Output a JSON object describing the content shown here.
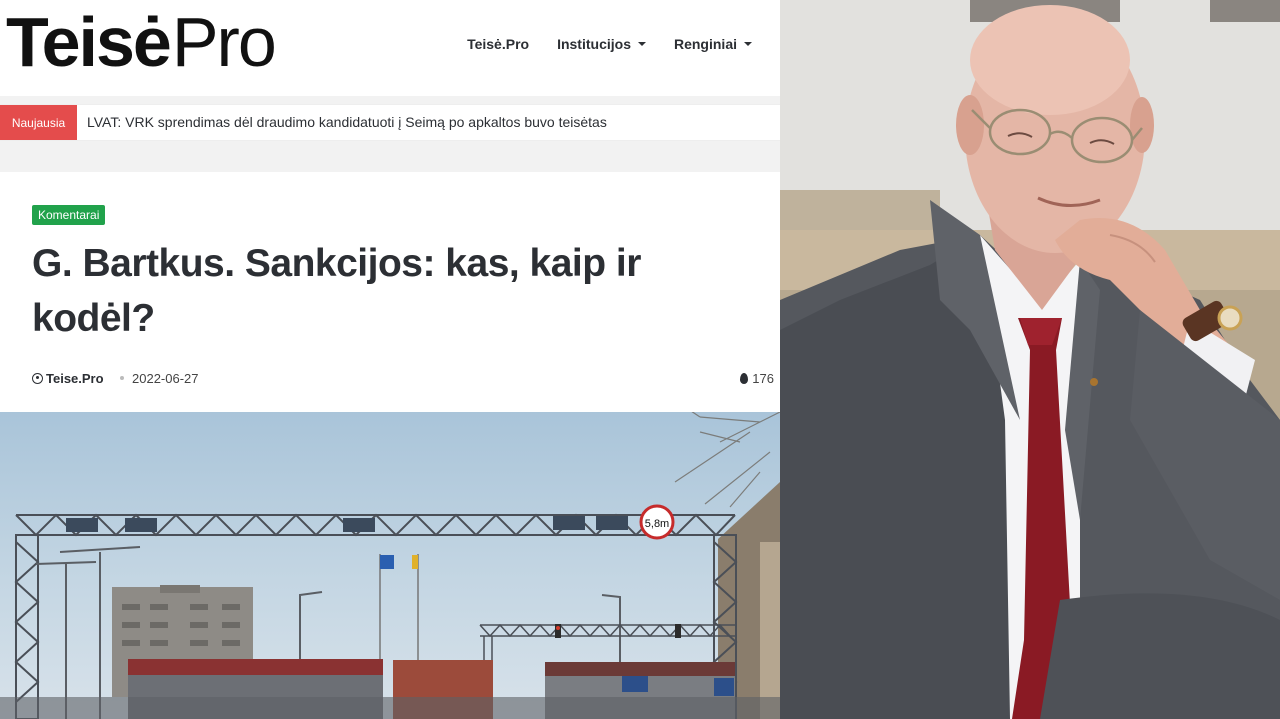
{
  "logo": {
    "bold": "Teisė",
    "light": "Pro"
  },
  "nav": {
    "items": [
      {
        "label": "Teisė.Pro",
        "dropdown": false
      },
      {
        "label": "Institucijos",
        "dropdown": true
      },
      {
        "label": "Renginiai",
        "dropdown": true
      }
    ]
  },
  "ticker": {
    "label": "Naujausia",
    "headline": "LVAT: VRK sprendimas dėl draudimo kandidatuoti į Seimą po apkaltos buvo teisėtas"
  },
  "article": {
    "category": "Komentarai",
    "title": "G. Bartkus. Sankcijos: kas, kaip ir kodėl?",
    "author": "Teise.Pro",
    "date": "2022-06-27",
    "views": "176"
  },
  "photo": {
    "height_sign": "5,8m"
  },
  "colors": {
    "ticker_label_bg": "#e44c4c",
    "category_bg": "#21a24b",
    "text": "#2c2f34"
  }
}
